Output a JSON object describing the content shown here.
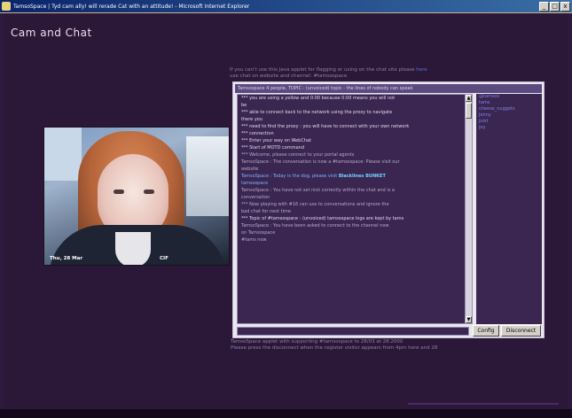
{
  "window": {
    "title": "TamsoSpace | Tyd cam ally! will rerade Cat with an attitude! - Microsoft Internet Explorer",
    "buttons": {
      "minimize": "_",
      "maximize": "□",
      "close": "x"
    }
  },
  "page": {
    "title": "Cam and Chat"
  },
  "webcam": {
    "timestamp": "Thu, 28 Mar",
    "format": "CIF"
  },
  "notice": {
    "text": "If you can't use this Java applet for flagging or using on the chat site please",
    "line2": "use chat on website and channel: #tamsospace",
    "link": "here"
  },
  "chat": {
    "header": "Tamsospace 4 people, TOPIC - (unvoiced) topic - the lines of nobody can speak",
    "lines": [
      {
        "text": "*** you are using a yellow and 0:00 because 0:00 means you will not",
        "style": "bright"
      },
      {
        "text": "be",
        "style": "bright"
      },
      {
        "text": "*** able to connect back to the network using the proxy to navigate",
        "style": "bright"
      },
      {
        "text": "there you",
        "style": "bright"
      },
      {
        "text": "*** need to find the proxy : you will have to connect with your own network",
        "style": "bright"
      },
      {
        "text": "*** connection",
        "style": "bright"
      },
      {
        "text": "*** Enter your way on WebChat",
        "style": "bright"
      },
      {
        "text": "*** Start of MOTD command",
        "style": "bright"
      },
      {
        "text": "*** Welcome, please connect to your portal agents",
        "style": "normal"
      },
      {
        "text": "TamsoSpace : The conversation is now a #tamsospace: Please visit our",
        "style": "normal"
      },
      {
        "text": "website",
        "style": "normal"
      },
      {
        "text": "TamsoSpace : Today is the dog, please visit",
        "style": "highlight",
        "highlight": "Blacklines BUNKET"
      },
      {
        "text": "tamsospace",
        "style": "highlight"
      },
      {
        "text": "TamsoSpace : You have not set nick correctly within the chat and is a",
        "style": "normal"
      },
      {
        "text": "conversation",
        "style": "normal"
      },
      {
        "text": "*** Now playing with #16 can use to conversations and ignore the",
        "style": "normal"
      },
      {
        "text": "bad chat for next time",
        "style": "normal"
      },
      {
        "text": "*** Topic of #tamsospace : (unvoiced) tamsospace logs are kept by tams",
        "style": "bright"
      },
      {
        "text": "TamsoSpace : You have been asked to connect to the channel now",
        "style": "normal"
      },
      {
        "text": "on Tamsospace",
        "style": "normal"
      },
      {
        "text": "#tams now",
        "style": "normal"
      }
    ],
    "users": [
      "@tamsos",
      "tams",
      "cheese_nuggets",
      "Jenny",
      "joist",
      "joy"
    ],
    "input_value": "",
    "buttons": {
      "config": "Config",
      "disconnect": "Disconnect"
    }
  },
  "footer": {
    "line1": "TamsoSpace applet with supporting #tamsospace to 28/03 at 28.2000",
    "line2": "Please press the disconnect when the register visitor appears from 4pm here and 28"
  },
  "colors": {
    "page_bg": "#2b1838",
    "chat_bg": "#3a2650",
    "link": "#5b6fd6"
  }
}
